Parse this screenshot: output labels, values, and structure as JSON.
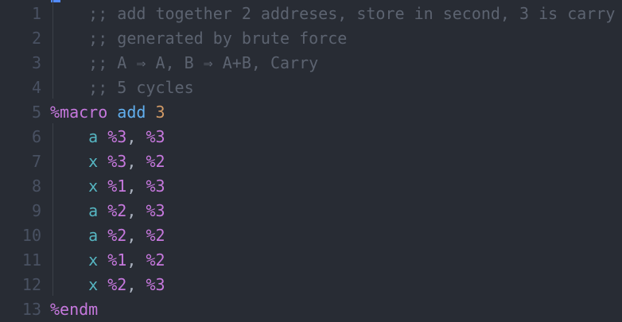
{
  "colors": {
    "background": "#282c34",
    "line_number": "#495162",
    "comment": "#5c6370",
    "macro": "#c678dd",
    "directive": "#61afef",
    "number": "#d19a66",
    "register": "#c678dd",
    "punct": "#abb2bf",
    "instruction": "#56b6c2"
  },
  "editor": {
    "lines": [
      {
        "num": "1",
        "indent": "    ",
        "tokens": [
          {
            "text": ";; add together 2 addreses, store in second, 3 is carry",
            "kind": "comment"
          }
        ]
      },
      {
        "num": "2",
        "indent": "    ",
        "tokens": [
          {
            "text": ";; generated by brute force",
            "kind": "comment"
          }
        ]
      },
      {
        "num": "3",
        "indent": "    ",
        "tokens": [
          {
            "text": ";; A ⇒ A, B ⇒ A+B, Carry",
            "kind": "comment"
          }
        ]
      },
      {
        "num": "4",
        "indent": "    ",
        "tokens": [
          {
            "text": ";; 5 cycles",
            "kind": "comment"
          }
        ]
      },
      {
        "num": "5",
        "indent": "",
        "tokens": [
          {
            "text": "%macro",
            "kind": "macro"
          },
          {
            "text": " ",
            "kind": "punct"
          },
          {
            "text": "add",
            "kind": "directive"
          },
          {
            "text": " ",
            "kind": "punct"
          },
          {
            "text": "3",
            "kind": "number"
          }
        ]
      },
      {
        "num": "6",
        "indent": "    ",
        "tokens": [
          {
            "text": "a",
            "kind": "instruction"
          },
          {
            "text": " ",
            "kind": "punct"
          },
          {
            "text": "%3",
            "kind": "register"
          },
          {
            "text": ", ",
            "kind": "punct"
          },
          {
            "text": "%3",
            "kind": "register"
          }
        ]
      },
      {
        "num": "7",
        "indent": "    ",
        "tokens": [
          {
            "text": "x",
            "kind": "instruction"
          },
          {
            "text": " ",
            "kind": "punct"
          },
          {
            "text": "%3",
            "kind": "register"
          },
          {
            "text": ", ",
            "kind": "punct"
          },
          {
            "text": "%2",
            "kind": "register"
          }
        ]
      },
      {
        "num": "8",
        "indent": "    ",
        "tokens": [
          {
            "text": "x",
            "kind": "instruction"
          },
          {
            "text": " ",
            "kind": "punct"
          },
          {
            "text": "%1",
            "kind": "register"
          },
          {
            "text": ", ",
            "kind": "punct"
          },
          {
            "text": "%3",
            "kind": "register"
          }
        ]
      },
      {
        "num": "9",
        "indent": "    ",
        "tokens": [
          {
            "text": "a",
            "kind": "instruction"
          },
          {
            "text": " ",
            "kind": "punct"
          },
          {
            "text": "%2",
            "kind": "register"
          },
          {
            "text": ", ",
            "kind": "punct"
          },
          {
            "text": "%3",
            "kind": "register"
          }
        ]
      },
      {
        "num": "10",
        "indent": "    ",
        "tokens": [
          {
            "text": "a",
            "kind": "instruction"
          },
          {
            "text": " ",
            "kind": "punct"
          },
          {
            "text": "%2",
            "kind": "register"
          },
          {
            "text": ", ",
            "kind": "punct"
          },
          {
            "text": "%2",
            "kind": "register"
          }
        ]
      },
      {
        "num": "11",
        "indent": "    ",
        "tokens": [
          {
            "text": "x",
            "kind": "instruction"
          },
          {
            "text": " ",
            "kind": "punct"
          },
          {
            "text": "%1",
            "kind": "register"
          },
          {
            "text": ", ",
            "kind": "punct"
          },
          {
            "text": "%2",
            "kind": "register"
          }
        ]
      },
      {
        "num": "12",
        "indent": "    ",
        "tokens": [
          {
            "text": "x",
            "kind": "instruction"
          },
          {
            "text": " ",
            "kind": "punct"
          },
          {
            "text": "%2",
            "kind": "register"
          },
          {
            "text": ", ",
            "kind": "punct"
          },
          {
            "text": "%3",
            "kind": "register"
          }
        ]
      },
      {
        "num": "13",
        "indent": "",
        "tokens": [
          {
            "text": "%endm",
            "kind": "macro"
          }
        ]
      }
    ]
  }
}
